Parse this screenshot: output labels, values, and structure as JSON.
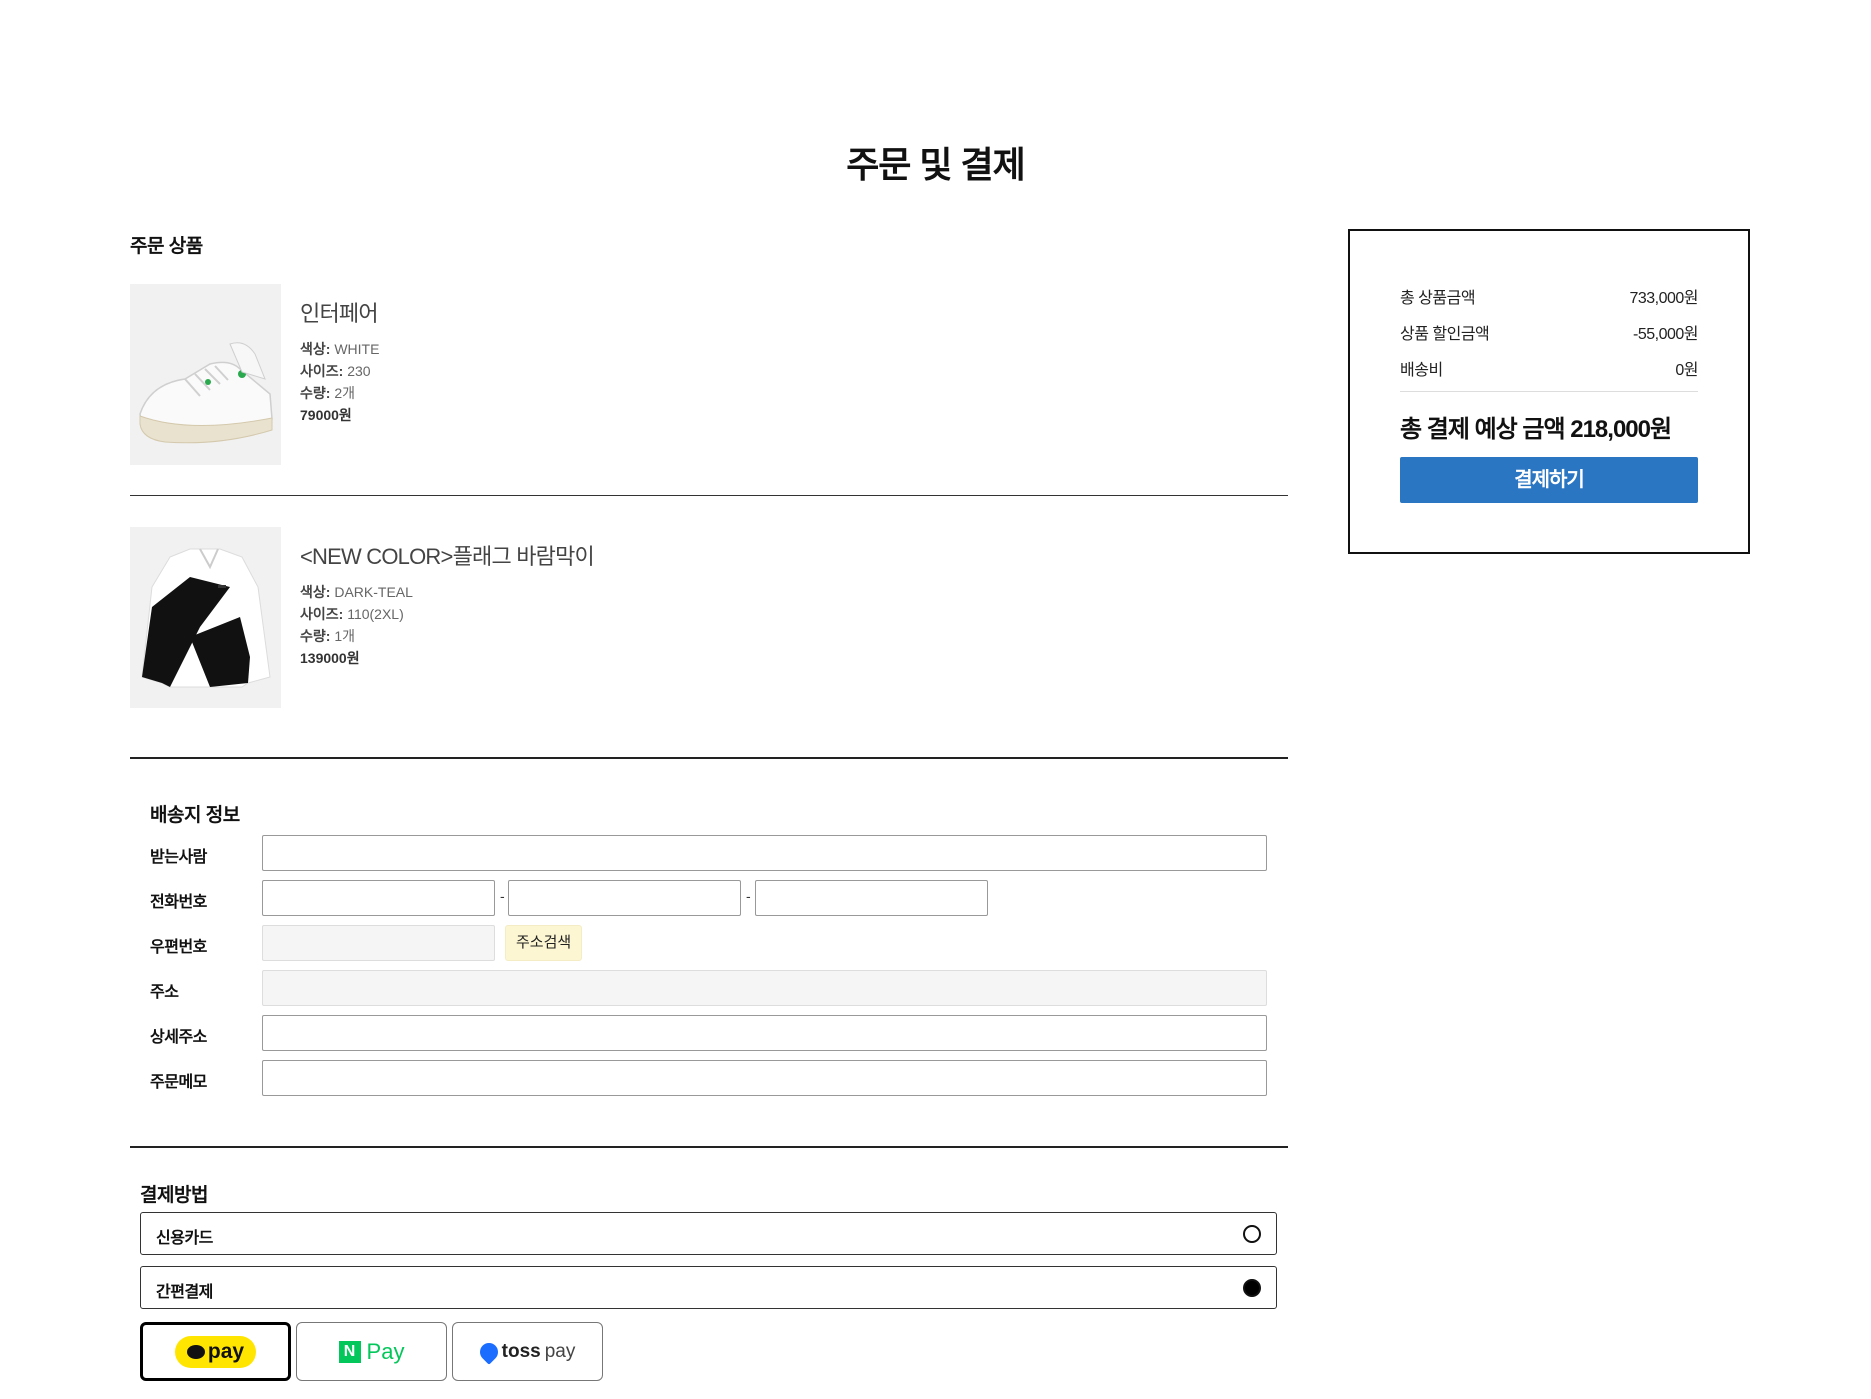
{
  "page": {
    "title": "주문 및 결제"
  },
  "order": {
    "section_title": "주문 상품",
    "items": [
      {
        "name": "인터페어",
        "color_label": "색상:",
        "color": "WHITE",
        "size_label": "사이즈:",
        "size": "230",
        "qty_label": "수량:",
        "qty": "2개",
        "price": "79000원"
      },
      {
        "name": "<NEW COLOR>플래그 바람막이",
        "color_label": "색상:",
        "color": "DARK-TEAL",
        "size_label": "사이즈:",
        "size": "110(2XL)",
        "qty_label": "수량:",
        "qty": "1개",
        "price": "139000원"
      }
    ]
  },
  "shipping": {
    "section_title": "배송지 정보",
    "recipient_label": "받는사람",
    "phone_label": "전화번호",
    "phone_sep": "-",
    "zip_label": "우편번호",
    "zip_button": "주소검색",
    "address_label": "주소",
    "detail_label": "상세주소",
    "memo_label": "주문메모"
  },
  "payment": {
    "section_title": "결제방법",
    "options": [
      {
        "label": "신용카드",
        "selected": false
      },
      {
        "label": "간편결제",
        "selected": true
      }
    ],
    "easy_pay": {
      "kakao": "pay",
      "naver_n": "N",
      "naver": "Pay",
      "toss_1": "toss",
      "toss_2": "pay"
    }
  },
  "summary": {
    "total_label": "총 상품금액",
    "total_value": "733,000원",
    "discount_label": "상품 할인금액",
    "discount_value": "-55,000원",
    "shipping_label": "배송비",
    "shipping_value": "0원",
    "final": "총 결제 예상 금액 218,000원",
    "pay_button": "결제하기",
    "pay_button_color": "#2b76c2"
  }
}
